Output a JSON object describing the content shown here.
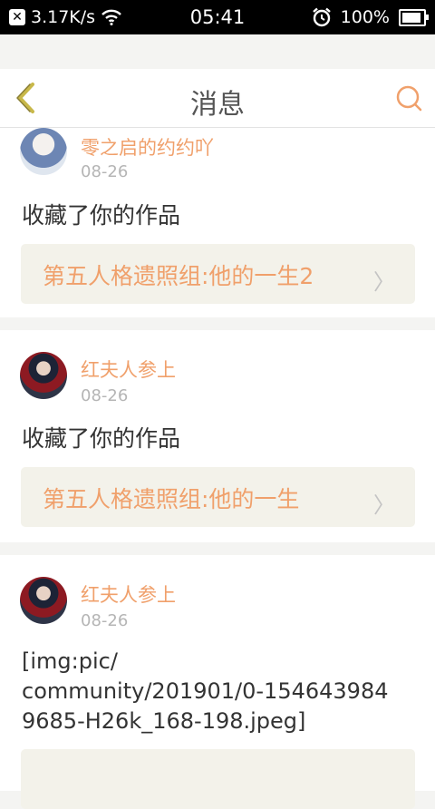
{
  "status_bar": {
    "network_speed": "3.17K/s",
    "time": "05:41",
    "battery": "100%",
    "icons": [
      "notification-x-icon",
      "wifi-icon",
      "alarm-icon",
      "battery-icon"
    ]
  },
  "header": {
    "title": "消息",
    "back_icon": "chevron-left-icon",
    "search_icon": "search-icon"
  },
  "colors": {
    "accent": "#f0a06b",
    "back": "#c8b84a",
    "card_link_bg": "#f3f2ea"
  },
  "messages": [
    {
      "user": "零之启的约约吖",
      "date": "08-26",
      "text": "收藏了你的作品",
      "work": "第五人格遗照组:他的一生2"
    },
    {
      "user": "红夫人参上",
      "date": "08-26",
      "text": "收藏了你的作品",
      "work": "第五人格遗照组:他的一生"
    },
    {
      "user": "红夫人参上",
      "date": "08-26",
      "text": "[img:pic/\ncommunity/201901/0-154643984\n9685-H26k_168-198.jpeg]"
    }
  ]
}
